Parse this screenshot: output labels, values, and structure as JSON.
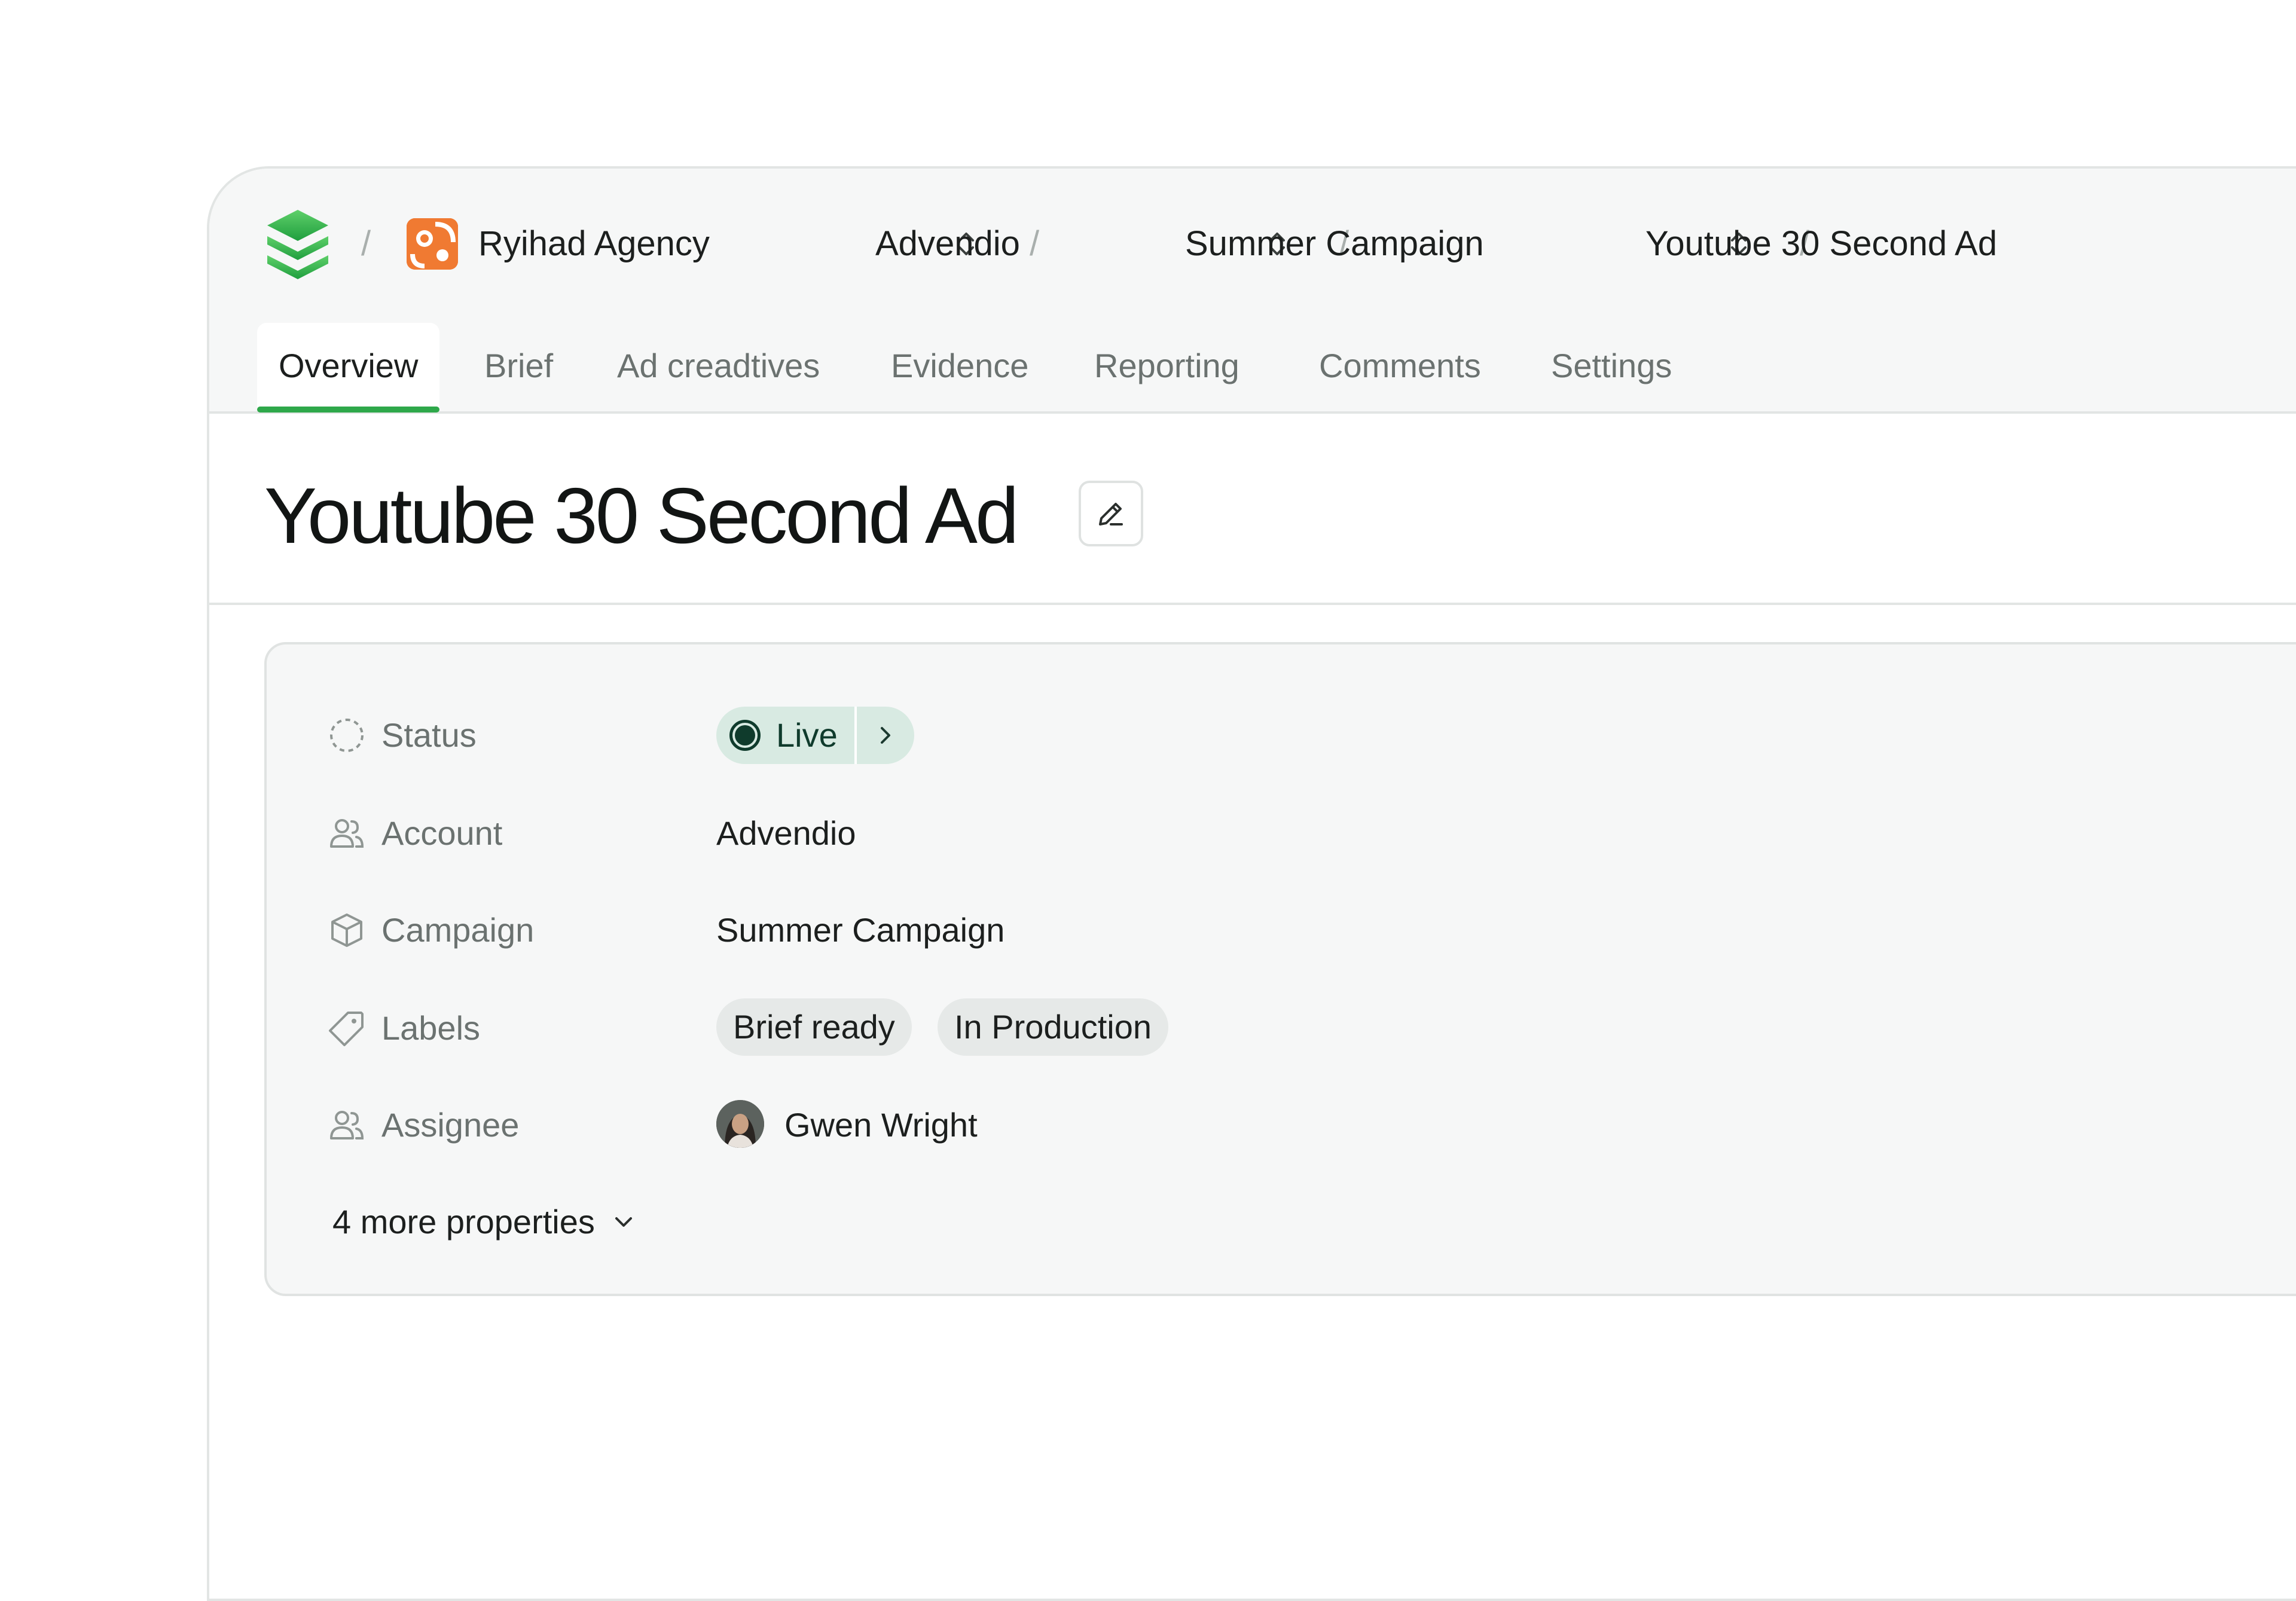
{
  "breadcrumb": {
    "separator": "/",
    "items": [
      {
        "label": "Ryihad Agency"
      },
      {
        "label": "Advendio"
      },
      {
        "label": "Summer Campaign"
      },
      {
        "label": "Youtube 30 Second Ad"
      }
    ]
  },
  "tabs": [
    {
      "label": "Overview",
      "active": true
    },
    {
      "label": "Brief"
    },
    {
      "label": "Ad creadtives"
    },
    {
      "label": "Evidence"
    },
    {
      "label": "Reporting"
    },
    {
      "label": "Comments"
    },
    {
      "label": "Settings"
    }
  ],
  "page": {
    "title": "Youtube 30 Second Ad"
  },
  "properties": {
    "status": {
      "label": "Status",
      "value": "Live",
      "icon": "dashed-circle-icon"
    },
    "account": {
      "label": "Account",
      "value": "Advendio",
      "icon": "users-icon"
    },
    "campaign": {
      "label": "Campaign",
      "value": "Summer Campaign",
      "icon": "cube-icon"
    },
    "labels": {
      "label": "Labels",
      "values": [
        "Brief ready",
        "In Production"
      ],
      "icon": "tag-icon"
    },
    "assignee": {
      "label": "Assignee",
      "value": "Gwen Wright",
      "icon": "users-icon"
    }
  },
  "more_properties": "4 more properties",
  "colors": {
    "accent_green": "#2ea84a",
    "status_bg": "#d8eae2",
    "status_fg": "#0f3b2c",
    "agency_orange": "#f07a32"
  }
}
